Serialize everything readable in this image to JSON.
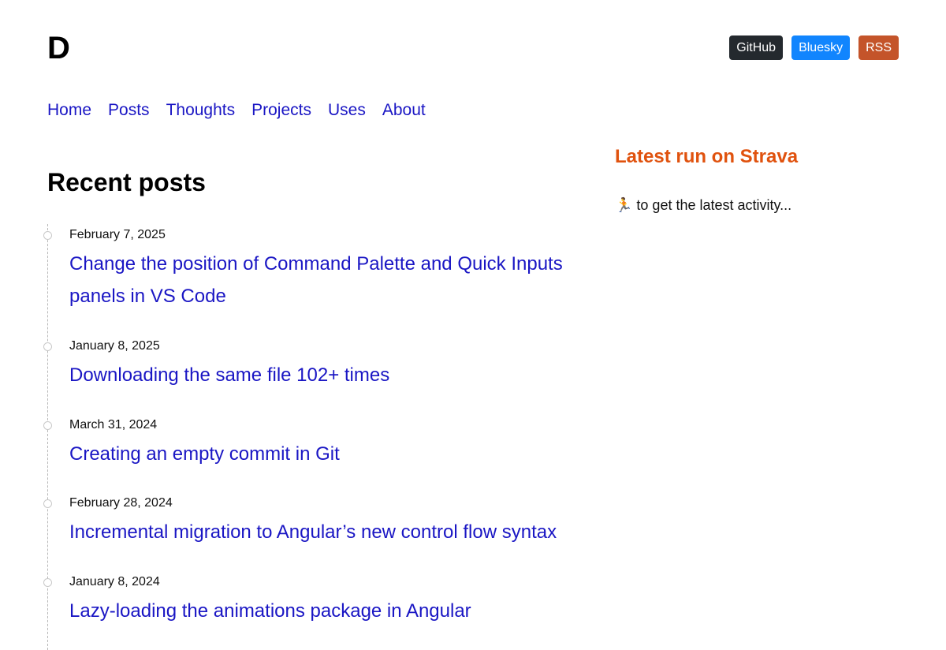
{
  "site": {
    "logo": "D"
  },
  "social": [
    {
      "label": "GitHub",
      "color": "#24292e"
    },
    {
      "label": "Bluesky",
      "color": "#1185fe"
    },
    {
      "label": "RSS",
      "color": "#c4542a"
    }
  ],
  "nav": [
    {
      "label": "Home"
    },
    {
      "label": "Posts"
    },
    {
      "label": "Thoughts"
    },
    {
      "label": "Projects"
    },
    {
      "label": "Uses"
    },
    {
      "label": "About"
    }
  ],
  "recent": {
    "heading": "Recent posts",
    "posts": [
      {
        "date": "February 7, 2025",
        "title": "Change the position of Command Palette and Quick Inputs panels in VS Code"
      },
      {
        "date": "January 8, 2025",
        "title": "Downloading the same file 102+ times"
      },
      {
        "date": "March 31, 2024",
        "title": "Creating an empty commit in Git"
      },
      {
        "date": "February 28, 2024",
        "title": "Incremental migration to Angular’s new control flow syntax"
      },
      {
        "date": "January 8, 2024",
        "title": "Lazy-loading the animations package in Angular"
      }
    ]
  },
  "strava": {
    "heading": "Latest run on Strava",
    "icon": "runner-icon",
    "icon_glyph": "🏃",
    "status": "to get the latest activity..."
  },
  "colors": {
    "link": "#1a16c4",
    "accent": "#e0520e"
  }
}
